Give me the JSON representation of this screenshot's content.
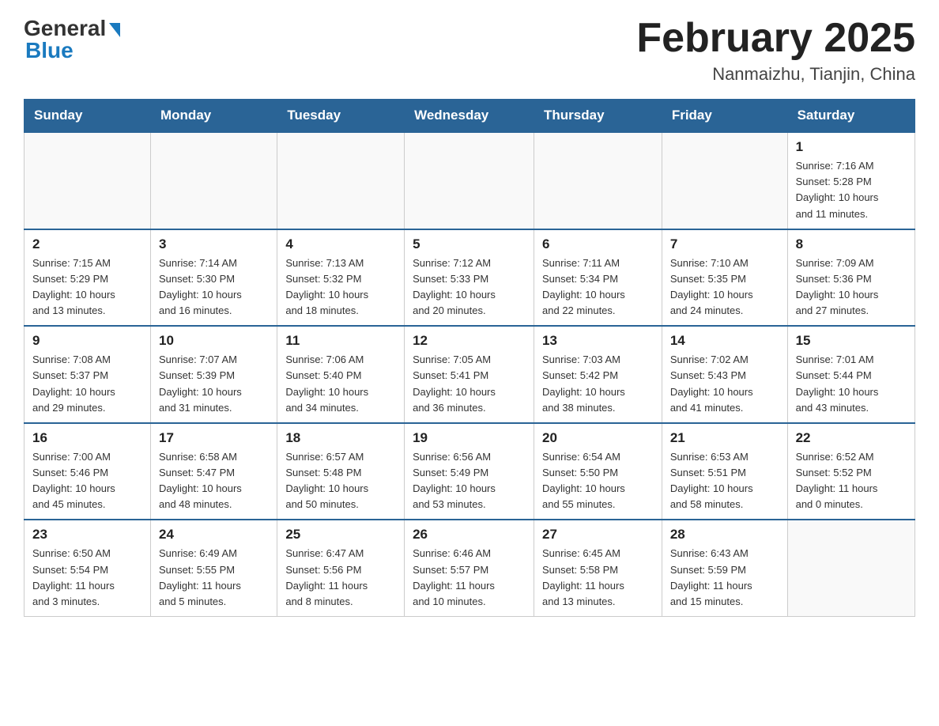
{
  "header": {
    "logo_general": "General",
    "logo_blue": "Blue",
    "title": "February 2025",
    "subtitle": "Nanmaizhu, Tianjin, China"
  },
  "days_of_week": [
    "Sunday",
    "Monday",
    "Tuesday",
    "Wednesday",
    "Thursday",
    "Friday",
    "Saturday"
  ],
  "weeks": [
    [
      {
        "day": "",
        "info": ""
      },
      {
        "day": "",
        "info": ""
      },
      {
        "day": "",
        "info": ""
      },
      {
        "day": "",
        "info": ""
      },
      {
        "day": "",
        "info": ""
      },
      {
        "day": "",
        "info": ""
      },
      {
        "day": "1",
        "info": "Sunrise: 7:16 AM\nSunset: 5:28 PM\nDaylight: 10 hours\nand 11 minutes."
      }
    ],
    [
      {
        "day": "2",
        "info": "Sunrise: 7:15 AM\nSunset: 5:29 PM\nDaylight: 10 hours\nand 13 minutes."
      },
      {
        "day": "3",
        "info": "Sunrise: 7:14 AM\nSunset: 5:30 PM\nDaylight: 10 hours\nand 16 minutes."
      },
      {
        "day": "4",
        "info": "Sunrise: 7:13 AM\nSunset: 5:32 PM\nDaylight: 10 hours\nand 18 minutes."
      },
      {
        "day": "5",
        "info": "Sunrise: 7:12 AM\nSunset: 5:33 PM\nDaylight: 10 hours\nand 20 minutes."
      },
      {
        "day": "6",
        "info": "Sunrise: 7:11 AM\nSunset: 5:34 PM\nDaylight: 10 hours\nand 22 minutes."
      },
      {
        "day": "7",
        "info": "Sunrise: 7:10 AM\nSunset: 5:35 PM\nDaylight: 10 hours\nand 24 minutes."
      },
      {
        "day": "8",
        "info": "Sunrise: 7:09 AM\nSunset: 5:36 PM\nDaylight: 10 hours\nand 27 minutes."
      }
    ],
    [
      {
        "day": "9",
        "info": "Sunrise: 7:08 AM\nSunset: 5:37 PM\nDaylight: 10 hours\nand 29 minutes."
      },
      {
        "day": "10",
        "info": "Sunrise: 7:07 AM\nSunset: 5:39 PM\nDaylight: 10 hours\nand 31 minutes."
      },
      {
        "day": "11",
        "info": "Sunrise: 7:06 AM\nSunset: 5:40 PM\nDaylight: 10 hours\nand 34 minutes."
      },
      {
        "day": "12",
        "info": "Sunrise: 7:05 AM\nSunset: 5:41 PM\nDaylight: 10 hours\nand 36 minutes."
      },
      {
        "day": "13",
        "info": "Sunrise: 7:03 AM\nSunset: 5:42 PM\nDaylight: 10 hours\nand 38 minutes."
      },
      {
        "day": "14",
        "info": "Sunrise: 7:02 AM\nSunset: 5:43 PM\nDaylight: 10 hours\nand 41 minutes."
      },
      {
        "day": "15",
        "info": "Sunrise: 7:01 AM\nSunset: 5:44 PM\nDaylight: 10 hours\nand 43 minutes."
      }
    ],
    [
      {
        "day": "16",
        "info": "Sunrise: 7:00 AM\nSunset: 5:46 PM\nDaylight: 10 hours\nand 45 minutes."
      },
      {
        "day": "17",
        "info": "Sunrise: 6:58 AM\nSunset: 5:47 PM\nDaylight: 10 hours\nand 48 minutes."
      },
      {
        "day": "18",
        "info": "Sunrise: 6:57 AM\nSunset: 5:48 PM\nDaylight: 10 hours\nand 50 minutes."
      },
      {
        "day": "19",
        "info": "Sunrise: 6:56 AM\nSunset: 5:49 PM\nDaylight: 10 hours\nand 53 minutes."
      },
      {
        "day": "20",
        "info": "Sunrise: 6:54 AM\nSunset: 5:50 PM\nDaylight: 10 hours\nand 55 minutes."
      },
      {
        "day": "21",
        "info": "Sunrise: 6:53 AM\nSunset: 5:51 PM\nDaylight: 10 hours\nand 58 minutes."
      },
      {
        "day": "22",
        "info": "Sunrise: 6:52 AM\nSunset: 5:52 PM\nDaylight: 11 hours\nand 0 minutes."
      }
    ],
    [
      {
        "day": "23",
        "info": "Sunrise: 6:50 AM\nSunset: 5:54 PM\nDaylight: 11 hours\nand 3 minutes."
      },
      {
        "day": "24",
        "info": "Sunrise: 6:49 AM\nSunset: 5:55 PM\nDaylight: 11 hours\nand 5 minutes."
      },
      {
        "day": "25",
        "info": "Sunrise: 6:47 AM\nSunset: 5:56 PM\nDaylight: 11 hours\nand 8 minutes."
      },
      {
        "day": "26",
        "info": "Sunrise: 6:46 AM\nSunset: 5:57 PM\nDaylight: 11 hours\nand 10 minutes."
      },
      {
        "day": "27",
        "info": "Sunrise: 6:45 AM\nSunset: 5:58 PM\nDaylight: 11 hours\nand 13 minutes."
      },
      {
        "day": "28",
        "info": "Sunrise: 6:43 AM\nSunset: 5:59 PM\nDaylight: 11 hours\nand 15 minutes."
      },
      {
        "day": "",
        "info": ""
      }
    ]
  ]
}
